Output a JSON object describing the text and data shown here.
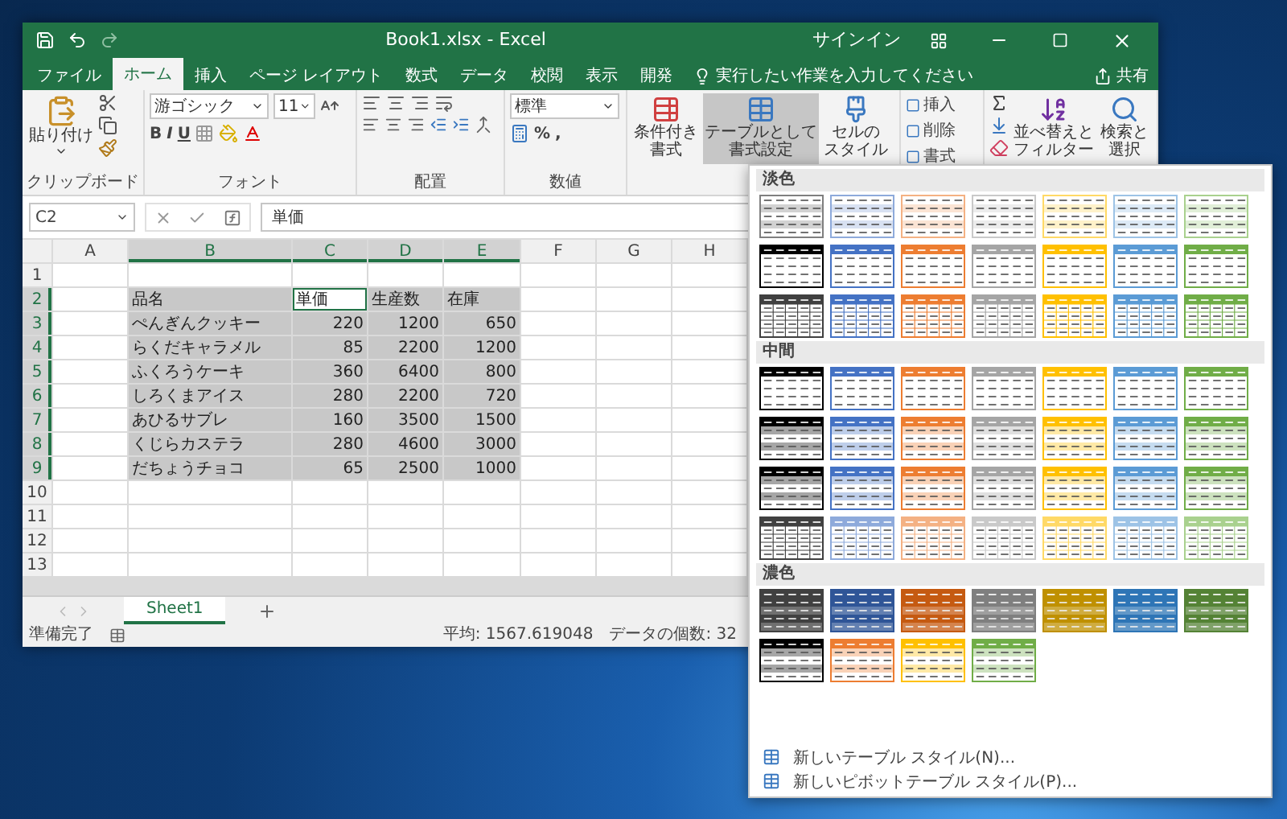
{
  "window": {
    "title": "Book1.xlsx  -  Excel",
    "sign_in": "サインイン"
  },
  "tabs": [
    {
      "label": "ファイル",
      "selected": false
    },
    {
      "label": "ホーム",
      "selected": true
    },
    {
      "label": "挿入",
      "selected": false
    },
    {
      "label": "ページ レイアウト",
      "selected": false
    },
    {
      "label": "数式",
      "selected": false
    },
    {
      "label": "データ",
      "selected": false
    },
    {
      "label": "校閲",
      "selected": false
    },
    {
      "label": "表示",
      "selected": false
    },
    {
      "label": "開発",
      "selected": false
    }
  ],
  "tell_me": "実行したい作業を入力してください",
  "share": "共有",
  "ribbon": {
    "clipboard": {
      "label": "クリップボード",
      "paste": "貼り付け"
    },
    "font": {
      "label": "フォント",
      "font_name": "游ゴシック",
      "font_size": "11",
      "styles": [
        "B",
        "I",
        "U"
      ]
    },
    "alignment": {
      "label": "配置"
    },
    "number": {
      "label": "数値",
      "format": "標準",
      "symbols": [
        "%",
        ","
      ]
    },
    "styles": [
      {
        "lines": [
          "条件付き",
          "書式"
        ],
        "selected": false
      },
      {
        "lines": [
          "テーブルとして",
          "書式設定"
        ],
        "selected": true
      },
      {
        "lines": [
          "セルの",
          "スタイル"
        ],
        "selected": false
      }
    ],
    "cells": [
      "挿入",
      "削除",
      "書式"
    ],
    "editing": [
      {
        "lines": [
          "並べ替えと",
          "フィルター"
        ]
      },
      {
        "lines": [
          "検索と",
          "選択"
        ]
      }
    ]
  },
  "formula_bar": {
    "name_box": "C2",
    "formula": "単価"
  },
  "sheet": {
    "columns": [
      {
        "label": "A",
        "selected": false
      },
      {
        "label": "B",
        "selected": true
      },
      {
        "label": "C",
        "selected": true
      },
      {
        "label": "D",
        "selected": true
      },
      {
        "label": "E",
        "selected": true
      },
      {
        "label": "F",
        "selected": false
      },
      {
        "label": "G",
        "selected": false
      },
      {
        "label": "H",
        "selected": false
      }
    ],
    "rows": [
      {
        "number": "1",
        "selected": false
      },
      {
        "number": "2",
        "selected": true,
        "cells": [
          {
            "text": "品名",
            "kind": "text",
            "active": false
          },
          {
            "text": "単価",
            "kind": "text",
            "active": true
          },
          {
            "text": "生産数",
            "kind": "text",
            "active": false
          },
          {
            "text": "在庫",
            "kind": "text",
            "active": false
          }
        ]
      },
      {
        "number": "3",
        "selected": true,
        "cells": [
          {
            "text": "ぺんぎんクッキー",
            "kind": "text",
            "active": false
          },
          {
            "text": "220",
            "kind": "number",
            "active": false
          },
          {
            "text": "1200",
            "kind": "number",
            "active": false
          },
          {
            "text": "650",
            "kind": "number",
            "active": false
          }
        ]
      },
      {
        "number": "4",
        "selected": true,
        "cells": [
          {
            "text": "らくだキャラメル",
            "kind": "text",
            "active": false
          },
          {
            "text": "85",
            "kind": "number",
            "active": false
          },
          {
            "text": "2200",
            "kind": "number",
            "active": false
          },
          {
            "text": "1200",
            "kind": "number",
            "active": false
          }
        ]
      },
      {
        "number": "5",
        "selected": true,
        "cells": [
          {
            "text": "ふくろうケーキ",
            "kind": "text",
            "active": false
          },
          {
            "text": "360",
            "kind": "number",
            "active": false
          },
          {
            "text": "6400",
            "kind": "number",
            "active": false
          },
          {
            "text": "800",
            "kind": "number",
            "active": false
          }
        ]
      },
      {
        "number": "6",
        "selected": true,
        "cells": [
          {
            "text": "しろくまアイス",
            "kind": "text",
            "active": false
          },
          {
            "text": "280",
            "kind": "number",
            "active": false
          },
          {
            "text": "2200",
            "kind": "number",
            "active": false
          },
          {
            "text": "720",
            "kind": "number",
            "active": false
          }
        ]
      },
      {
        "number": "7",
        "selected": true,
        "cells": [
          {
            "text": "あひるサブレ",
            "kind": "text",
            "active": false
          },
          {
            "text": "160",
            "kind": "number",
            "active": false
          },
          {
            "text": "3500",
            "kind": "number",
            "active": false
          },
          {
            "text": "1500",
            "kind": "number",
            "active": false
          }
        ]
      },
      {
        "number": "8",
        "selected": true,
        "cells": [
          {
            "text": "くじらカステラ",
            "kind": "text",
            "active": false
          },
          {
            "text": "280",
            "kind": "number",
            "active": false
          },
          {
            "text": "4600",
            "kind": "number",
            "active": false
          },
          {
            "text": "3000",
            "kind": "number",
            "active": false
          }
        ]
      },
      {
        "number": "9",
        "selected": true,
        "cells": [
          {
            "text": "だちょうチョコ",
            "kind": "text",
            "active": false
          },
          {
            "text": "65",
            "kind": "number",
            "active": false
          },
          {
            "text": "2500",
            "kind": "number",
            "active": false
          },
          {
            "text": "1000",
            "kind": "number",
            "active": false
          }
        ]
      },
      {
        "number": "10",
        "selected": false
      },
      {
        "number": "11",
        "selected": false
      },
      {
        "number": "12",
        "selected": false
      },
      {
        "number": "13",
        "selected": false
      }
    ]
  },
  "sheet_tabs": [
    {
      "label": "Sheet1",
      "selected": true
    }
  ],
  "status_bar": {
    "status": "準備完了",
    "average": "平均: 1567.619048",
    "count": "データの個数: 32"
  },
  "gallery": {
    "sections": [
      {
        "title": "淡色",
        "rows": [
          {
            "kind": "light",
            "swatches": [
              {
                "color": "#7f7f7f"
              },
              {
                "color": "#8eaadb"
              },
              {
                "color": "#f4b183"
              },
              {
                "color": "#c9c9c9"
              },
              {
                "color": "#ffd966"
              },
              {
                "color": "#9dc3e6"
              },
              {
                "color": "#a9d18e"
              }
            ]
          },
          {
            "kind": "header",
            "swatches": [
              {
                "color": "#000000"
              },
              {
                "color": "#4472c4"
              },
              {
                "color": "#ed7d31"
              },
              {
                "color": "#a5a5a5"
              },
              {
                "color": "#ffc000"
              },
              {
                "color": "#5b9bd5"
              },
              {
                "color": "#70ad47"
              }
            ]
          },
          {
            "kind": "grid",
            "swatches": [
              {
                "color": "#404040"
              },
              {
                "color": "#4472c4"
              },
              {
                "color": "#ed7d31"
              },
              {
                "color": "#a5a5a5"
              },
              {
                "color": "#ffc000"
              },
              {
                "color": "#5b9bd5"
              },
              {
                "color": "#70ad47"
              }
            ]
          }
        ]
      },
      {
        "title": "中間",
        "rows": [
          {
            "kind": "header",
            "swatches": [
              {
                "color": "#000000"
              },
              {
                "color": "#4472c4"
              },
              {
                "color": "#ed7d31"
              },
              {
                "color": "#a5a5a5"
              },
              {
                "color": "#ffc000"
              },
              {
                "color": "#5b9bd5"
              },
              {
                "color": "#70ad47"
              }
            ]
          },
          {
            "kind": "medium",
            "swatches": [
              {
                "color": "#000000"
              },
              {
                "color": "#4472c4"
              },
              {
                "color": "#ed7d31"
              },
              {
                "color": "#a5a5a5"
              },
              {
                "color": "#ffc000"
              },
              {
                "color": "#5b9bd5"
              },
              {
                "color": "#70ad47"
              }
            ]
          },
          {
            "kind": "medium",
            "swatches": [
              {
                "color": "#000000"
              },
              {
                "color": "#4472c4"
              },
              {
                "color": "#ed7d31"
              },
              {
                "color": "#a5a5a5"
              },
              {
                "color": "#ffc000"
              },
              {
                "color": "#5b9bd5"
              },
              {
                "color": "#70ad47"
              }
            ]
          },
          {
            "kind": "grid",
            "swatches": [
              {
                "color": "#404040"
              },
              {
                "color": "#8eaadb"
              },
              {
                "color": "#f4b183"
              },
              {
                "color": "#c9c9c9"
              },
              {
                "color": "#ffd966"
              },
              {
                "color": "#9dc3e6"
              },
              {
                "color": "#a9d18e"
              }
            ]
          }
        ]
      },
      {
        "title": "濃色",
        "rows": [
          {
            "kind": "dark",
            "swatches": [
              {
                "color": "#404040"
              },
              {
                "color": "#2f5597"
              },
              {
                "color": "#c55a11"
              },
              {
                "color": "#7f7f7f"
              },
              {
                "color": "#bf9000"
              },
              {
                "color": "#2e75b6"
              },
              {
                "color": "#548235"
              }
            ]
          },
          {
            "kind": "medium",
            "swatches": [
              {
                "color": "#000000"
              },
              {
                "color": "#ed7d31"
              },
              {
                "color": "#ffc000"
              },
              {
                "color": "#70ad47"
              }
            ]
          }
        ]
      }
    ],
    "actions": [
      "新しいテーブル スタイル(N)...",
      "新しいピボットテーブル スタイル(P)..."
    ]
  }
}
